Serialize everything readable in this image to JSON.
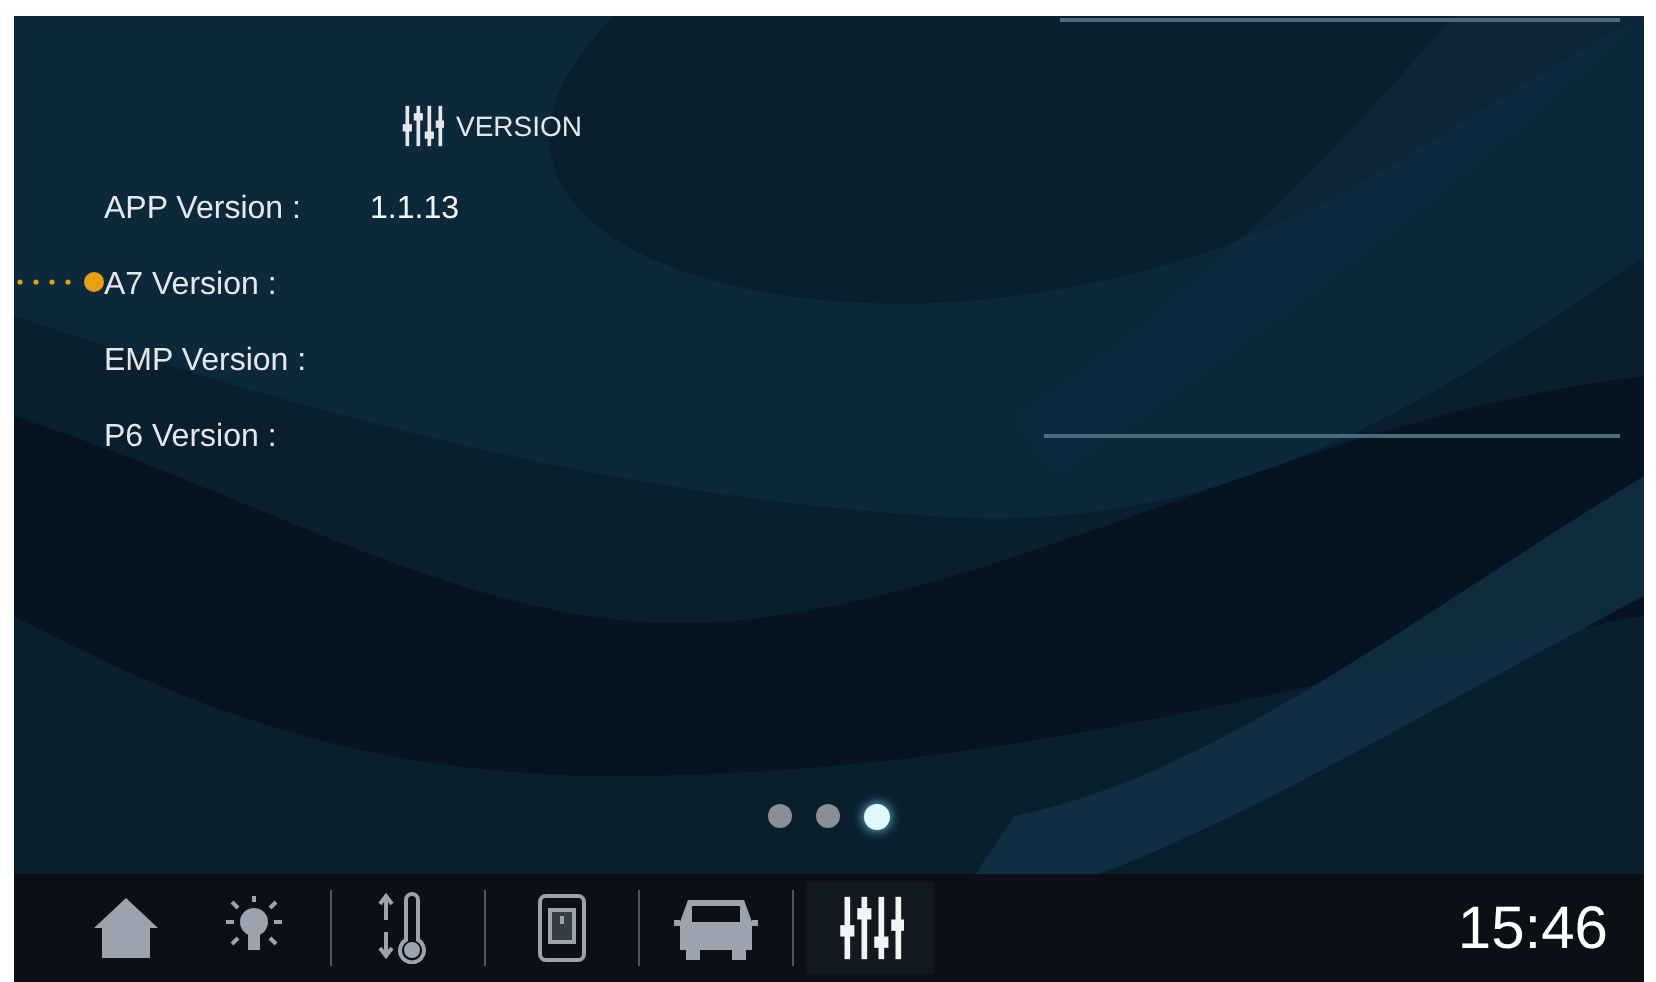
{
  "section": {
    "title": "VERSION"
  },
  "versions": [
    {
      "label": "APP Version :",
      "value": "1.1.13"
    },
    {
      "label": "A7 Version :"
    },
    {
      "label": "EMP Version :"
    },
    {
      "label": "P6 Version :"
    }
  ],
  "annotation": {
    "color": "#e8a013"
  },
  "pages": [
    {
      "selected": false
    },
    {
      "selected": false
    },
    {
      "selected": true
    }
  ],
  "nav": [
    {
      "kind": "home",
      "selected": false
    },
    {
      "kind": "light",
      "selected": false
    },
    {
      "kind": "climate",
      "selected": false
    },
    {
      "kind": "switch",
      "selected": false
    },
    {
      "kind": "vehicle",
      "selected": false
    },
    {
      "kind": "settings",
      "selected": true
    }
  ],
  "clock": "15:46"
}
